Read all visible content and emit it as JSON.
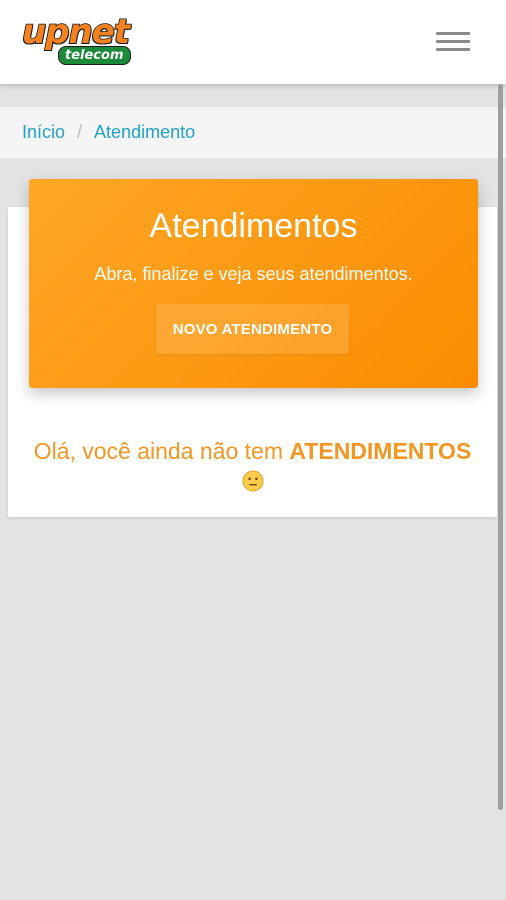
{
  "header": {
    "logo": {
      "brand": "upnet",
      "sub": "telecom"
    },
    "menu_icon": "hamburger-menu-icon"
  },
  "breadcrumb": {
    "items": [
      {
        "label": "Início"
      },
      {
        "label": "Atendimento"
      }
    ],
    "separator": "/"
  },
  "banner": {
    "title": "Atendimentos",
    "subtitle": "Abra, finalize e veja seus atendimentos.",
    "button_label": "NOVO ATENDIMENTO"
  },
  "empty_state": {
    "message": "Olá, você ainda não tem ",
    "highlight": "ATENDIMENTOS",
    "emoji_icon": "neutral-smiley-icon"
  },
  "colors": {
    "accent_orange": "#fb8c00",
    "banner_light": "#ffa726",
    "link_blue": "#1fa3c6",
    "page_bg": "#e3e3e3",
    "logo_green": "#1d8a3b"
  }
}
